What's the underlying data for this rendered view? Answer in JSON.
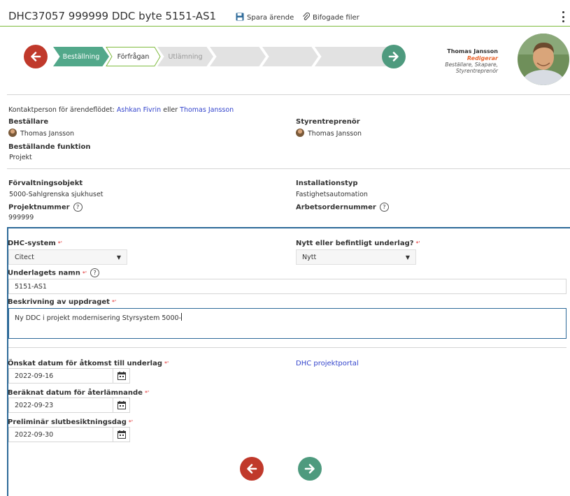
{
  "header": {
    "title": "DHC37057 999999 DDC byte 5151-AS1",
    "save_label": "Spara ärende",
    "attach_label": "Bifogade filer"
  },
  "stepper": {
    "steps": [
      {
        "label": "Beställning",
        "state": "done"
      },
      {
        "label": "Förfrågan",
        "state": "active"
      },
      {
        "label": "Utlämning",
        "state": "todo"
      },
      {
        "label": "",
        "state": "todo"
      },
      {
        "label": "",
        "state": "todo"
      },
      {
        "label": "",
        "state": "todo"
      },
      {
        "label": "",
        "state": "todo"
      }
    ]
  },
  "profile": {
    "name": "Thomas Jansson",
    "edit_label": "Redigerar",
    "roles": "Beställare, Skapare, Styrentreprenör"
  },
  "contact": {
    "prefix": "Kontaktperson för ärendeflödet:",
    "person1": "Ashkan Fivrin",
    "joiner": "eller",
    "person2": "Thomas Jansson"
  },
  "info": {
    "bestallare_label": "Beställare",
    "bestallare_value": "Thomas Jansson",
    "styrentreprenor_label": "Styrentreprenör",
    "styrentreprenor_value": "Thomas Jansson",
    "funktion_label": "Beställande funktion",
    "funktion_value": "Projekt",
    "forvaltning_label": "Förvaltningsobjekt",
    "forvaltning_value": "5000-Sahlgrenska sjukhuset",
    "installation_label": "Installationstyp",
    "installation_value": "Fastighetsautomation",
    "projektnummer_label": "Projektnummer",
    "projektnummer_value": "999999",
    "arbetsorder_label": "Arbetsordernummer"
  },
  "form": {
    "required_mark": "*'",
    "help_glyph": "?",
    "dhc_system_label": "DHC-system",
    "dhc_system_value": "Citect",
    "underlag_type_label": "Nytt eller befintligt underlag?",
    "underlag_type_value": "Nytt",
    "underlag_name_label": "Underlagets namn",
    "underlag_name_value": "5151-AS1",
    "beskrivning_label": "Beskrivning av uppdraget",
    "beskrivning_value": "Ny DDC i projekt modernisering Styrsystem 5000-",
    "date1_label": "Önskat datum för åtkomst till underlag",
    "date1_value": "2022-09-16",
    "portal_link": "DHC projektportal",
    "date2_label": "Beräknat datum för återlämnande",
    "date2_value": "2022-09-23",
    "date3_label": "Preliminär slutbesiktningsdag",
    "date3_value": "2022-09-30"
  },
  "colors": {
    "accent_green": "#52a88a",
    "arrow_red": "#c0392b",
    "arrow_green": "#4e9a7e",
    "link_blue": "#3344cc",
    "form_border": "#2d6a99",
    "header_line": "#7fbb3f",
    "edit_orange": "#e8642c"
  }
}
